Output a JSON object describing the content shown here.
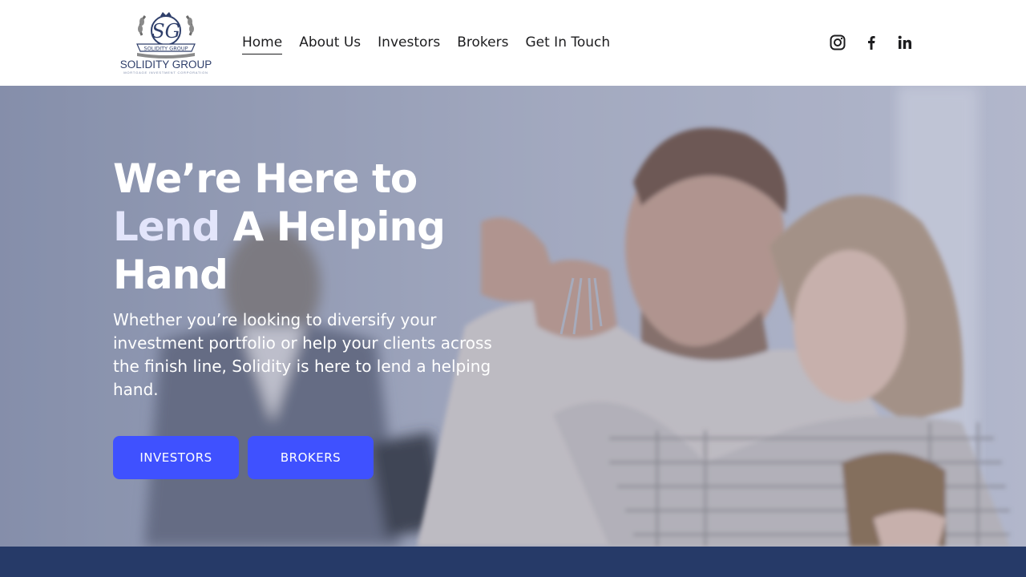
{
  "header": {
    "logo": {
      "monogram": "SG",
      "ribbon_text": "SOLIDITY GROUP",
      "wordmark": "SOLIDITY GROUP",
      "tagline": "MORTGAGE INVESTMENT CORPORATION"
    },
    "nav": [
      {
        "label": "Home",
        "active": true
      },
      {
        "label": "About Us",
        "active": false
      },
      {
        "label": "Investors",
        "active": false
      },
      {
        "label": "Brokers",
        "active": false
      },
      {
        "label": "Get In Touch",
        "active": false
      }
    ],
    "social_icons": [
      "instagram-icon",
      "facebook-icon",
      "linkedin-icon"
    ]
  },
  "hero": {
    "headline": {
      "line1": "We’re Here to",
      "accent": "Lend",
      "line2_rest": " A Helping",
      "line3": "Hand"
    },
    "subtext": "Whether you’re looking to diversify your investment portfolio or help your clients across the finish line, Solidity is here to lend a helping hand.",
    "buttons": {
      "investors": "INVESTORS",
      "brokers": "BROKERS"
    }
  },
  "colors": {
    "button_bg": "#3f51ff",
    "band_bg": "#263a68",
    "accent_text": "#e3e5fb",
    "logo_navy": "#2f3f6b"
  }
}
